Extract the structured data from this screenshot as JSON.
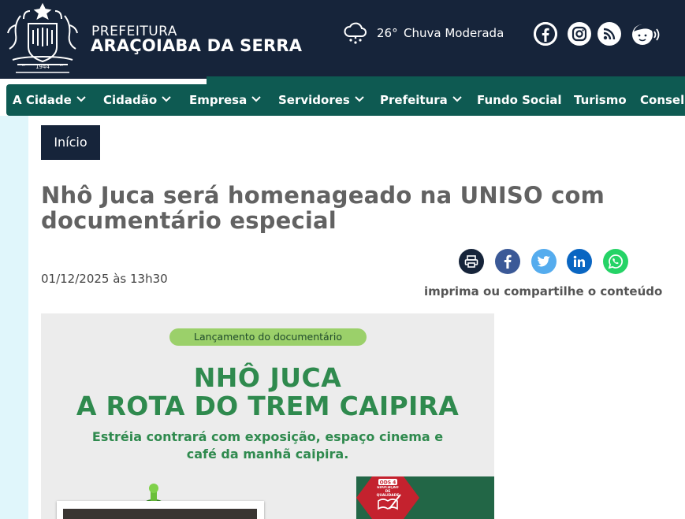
{
  "brand": {
    "top": "PREFEITURA",
    "main": "ARAÇOIABA DA SERRA",
    "emblem_year": "1944"
  },
  "weather": {
    "icon": "cloud-rain-icon",
    "temp": "26°",
    "desc": "Chuva Moderada"
  },
  "social_icons": [
    "facebook-icon",
    "instagram-icon",
    "rss-icon",
    "accessibility-icon"
  ],
  "nav": {
    "items": [
      {
        "label": "A Cidade",
        "has_dropdown": true
      },
      {
        "label": "Cidadão",
        "has_dropdown": true
      },
      {
        "label": "Empresa",
        "has_dropdown": true
      },
      {
        "label": "Servidores",
        "has_dropdown": true
      },
      {
        "label": "Prefeitura",
        "has_dropdown": true
      },
      {
        "label": "Fundo Social",
        "has_dropdown": false
      },
      {
        "label": "Turismo",
        "has_dropdown": false
      },
      {
        "label": "Consel",
        "has_dropdown": false
      }
    ]
  },
  "breadcrumb": "Início",
  "article": {
    "title": "Nhô Juca será homenageado na UNISO com documentário especial",
    "date": "01/12/2025 às 13h30"
  },
  "share": {
    "buttons": [
      "print-icon",
      "facebook-icon",
      "twitter-icon",
      "linkedin-icon",
      "whatsapp-icon"
    ],
    "caption": "imprima ou compartilhe o conteúdo"
  },
  "feature_image": {
    "pill": "Lançamento do documentário",
    "headline1": "NHÔ JUCA",
    "headline2": "A ROTA DO TREM CAIPIRA",
    "sub1": "Estréia contrará com exposição, espaço cinema e",
    "sub2": "café da manhã caipira.",
    "badge_top": "ODS 4",
    "badge_bottom": "EDUCAÇÃO DE QUALIDADE"
  },
  "colors": {
    "header_bg": "#16243a",
    "nav_bg": "#0e5a52",
    "title_text": "#626262",
    "headline_green": "#2f8a4e",
    "pill_green": "#9bd06a",
    "badge_red": "#c4222e"
  }
}
